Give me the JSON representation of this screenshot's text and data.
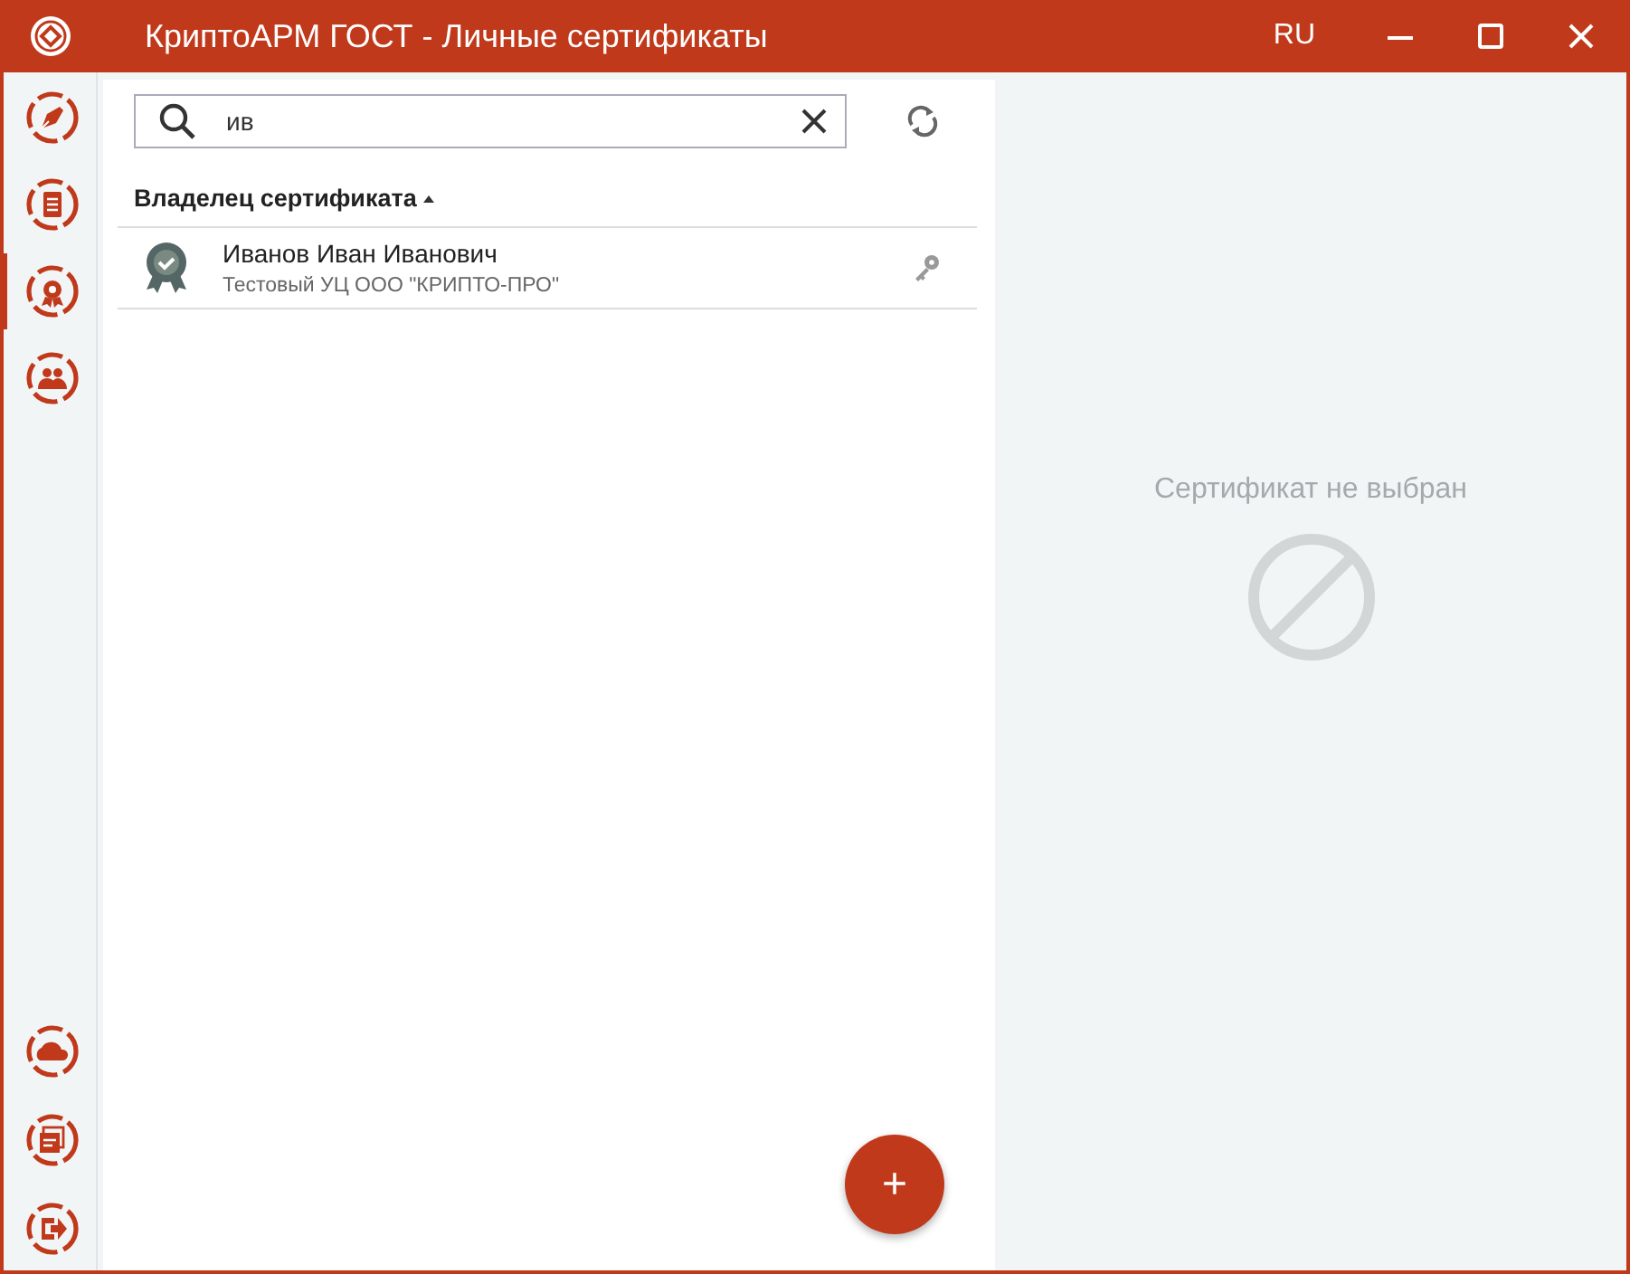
{
  "window": {
    "title": "КриптоАРМ ГОСТ - Личные сертификаты",
    "language": "RU"
  },
  "sidebar": {
    "top_items": [
      {
        "selected": false
      },
      {
        "selected": false
      },
      {
        "selected": true
      },
      {
        "selected": false
      }
    ],
    "bottom_items": [
      {
        "selected": false
      },
      {
        "selected": false
      },
      {
        "selected": false
      }
    ]
  },
  "search": {
    "value": "ив"
  },
  "list": {
    "column": "Владелец сертификата",
    "rows": [
      {
        "name": "Иванов Иван Иванович",
        "issuer": "Тестовый УЦ ООО \"КРИПТО-ПРО\"",
        "selected": false
      }
    ]
  },
  "add_button": "+",
  "details": {
    "empty_text": "Сертификат не выбран"
  }
}
